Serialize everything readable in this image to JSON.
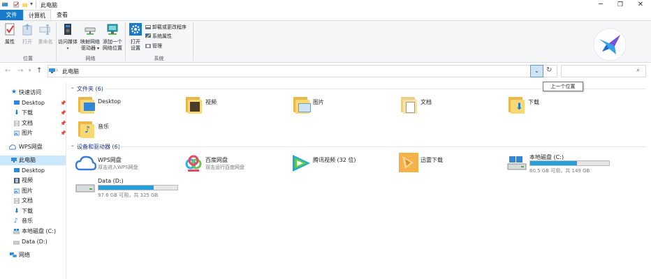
{
  "window": {
    "title": "此电脑",
    "controls": [
      "minimize-icon",
      "restore-icon",
      "close-icon"
    ]
  },
  "tabs": [
    {
      "label": "文件",
      "active": false
    },
    {
      "label": "计算机",
      "active": true
    },
    {
      "label": "查看",
      "active": false
    }
  ],
  "ribbon": {
    "groups": [
      {
        "label": "位置",
        "buttons": [
          {
            "label": "属性",
            "icon": "properties-icon",
            "enabled": true
          },
          {
            "label": "打开",
            "icon": "open-icon",
            "enabled": false
          },
          {
            "label": "重命名",
            "icon": "rename-icon",
            "enabled": false
          }
        ]
      },
      {
        "label": "网络",
        "buttons": [
          {
            "label": "访问媒体",
            "icon": "media-icon",
            "enabled": true
          },
          {
            "label": "映射网络",
            "label2": "驱动器",
            "icon": "map-drive-icon",
            "enabled": true
          },
          {
            "label": "添加一个",
            "label2": "网络位置",
            "icon": "network-location-icon",
            "enabled": true
          }
        ]
      },
      {
        "label": "系统",
        "buttons": [
          {
            "label": "打开",
            "label2": "设置",
            "icon": "settings-icon",
            "enabled": true
          }
        ],
        "commands": [
          {
            "label": "卸载或更改程序",
            "icon": "uninstall-icon"
          },
          {
            "label": "系统属性",
            "icon": "system-properties-icon"
          },
          {
            "label": "管理",
            "icon": "manage-icon"
          }
        ]
      }
    ]
  },
  "address": {
    "path": "此电脑",
    "dropdown_tooltip": "上一个位置"
  },
  "nav": {
    "quick_access": "快速访问",
    "quick_items": [
      "Desktop",
      "下载",
      "文档",
      "图片"
    ],
    "wps": "WPS网盘",
    "this_pc": "此电脑",
    "pc_items": [
      "Desktop",
      "视频",
      "图片",
      "文档",
      "下载",
      "音乐",
      "本地磁盘 (C:)",
      "Data (D:)"
    ],
    "network": "网络"
  },
  "content": {
    "folders_header": "文件夹 (6)",
    "folders": [
      "Desktop",
      "视频",
      "图片",
      "文档",
      "下载",
      "音乐"
    ],
    "devices_header": "设备和驱动器 (6)",
    "devices": [
      {
        "name": "WPS网盘",
        "sub": "双击进入WPS网盘",
        "icon": "wps-cloud-icon"
      },
      {
        "name": "百度网盘",
        "sub": "双击运行百度网盘",
        "icon": "baidu-netdisk-icon"
      },
      {
        "name": "腾讯视频 (32 位)",
        "sub": "",
        "icon": "tencent-video-icon"
      },
      {
        "name": "迅雷下载",
        "sub": "",
        "icon": "xunlei-icon"
      },
      {
        "name": "本地磁盘 (C:)",
        "sub": "60.5 GB 可用，共 149 GB",
        "icon": "local-disk-icon",
        "used_fraction": 0.59
      },
      {
        "name": "Data (D:)",
        "sub": "97.6 GB 可用，共 325 GB",
        "icon": "data-disk-icon",
        "used_fraction": 0.7
      }
    ]
  },
  "colors": {
    "accent": "#1979ca",
    "selection": "#cce8ff",
    "drive_bar": "#26a0da",
    "section_header": "#1e3287"
  }
}
